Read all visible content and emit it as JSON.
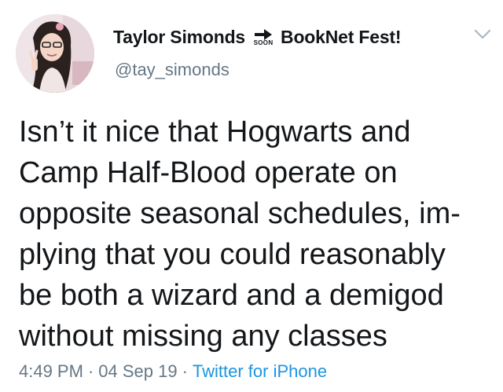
{
  "author": {
    "display_name": "Taylor Simonds",
    "badge_text": "SOON",
    "event_name": "BookNet Fest!",
    "handle": "@tay_simonds"
  },
  "tweet": {
    "lines": [
      "Isn’t it nice that Hogwarts and",
      "Camp Half-Blood operate on",
      "opposite seasonal schedules, im-",
      "plying that you could reasonably",
      "be both a wizard and a demigod",
      "without missing any classes"
    ]
  },
  "meta": {
    "time": "4:49 PM",
    "separator": "·",
    "date": "04 Sep 19",
    "source": "Twitter for iPhone"
  },
  "icons": {
    "avatar": "profile-photo",
    "arrow": "arrow-right-icon",
    "menu": "chevron-down-icon"
  },
  "colors": {
    "text": "#14171a",
    "secondary": "#657786",
    "link": "#1b95e0"
  }
}
